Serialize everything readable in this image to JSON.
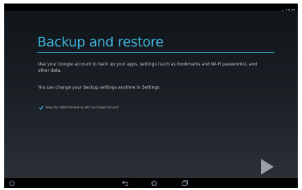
{
  "status_bar": {
    "time": "10:01",
    "icons": [
      "wifi-icon",
      "battery-icon"
    ]
  },
  "setup": {
    "title": "Backup and restore",
    "description": "Use your Google account to back up your apps, settings (such as bookmarks and Wi-Fi passwords), and other data.",
    "change_note": "You can change your backup settings anytime in Settings.",
    "backup_option": {
      "label": "Keep this tablet backed up with my Google Account",
      "checked": true
    },
    "next_button": "next-arrow-icon"
  },
  "nav_bar": {
    "buttons": [
      "home-outline-icon",
      "back-icon",
      "home-icon",
      "recents-icon"
    ]
  },
  "colors": {
    "accent": "#3fb3da",
    "text": "#c5cacd",
    "background": "#1b2126"
  }
}
